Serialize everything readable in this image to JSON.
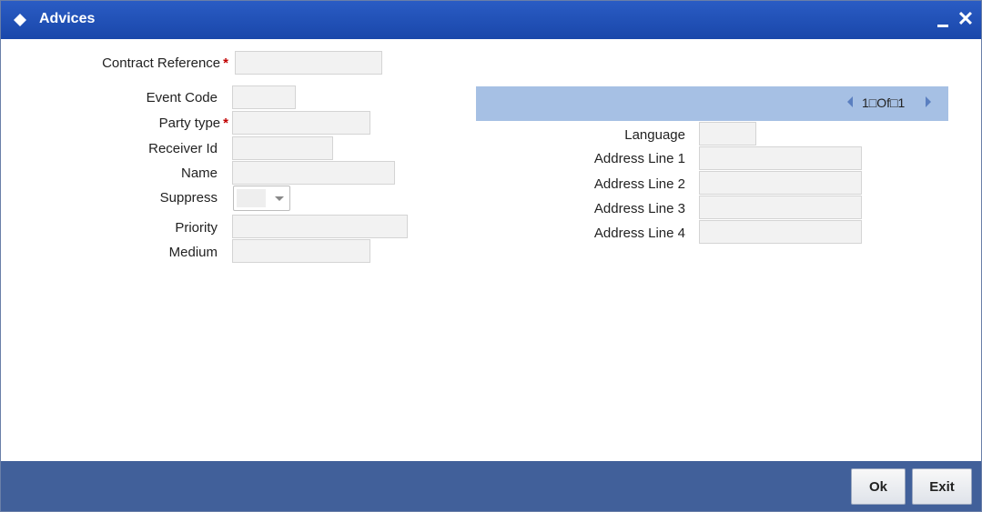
{
  "window": {
    "title": "Advices",
    "close_glyph": "✕"
  },
  "form": {
    "contract_reference": {
      "label": "Contract Reference",
      "required": "*",
      "value": ""
    },
    "event_code": {
      "label": "Event Code",
      "value": ""
    },
    "party_type": {
      "label": "Party type",
      "required": "*",
      "value": ""
    },
    "receiver_id": {
      "label": "Receiver Id",
      "value": ""
    },
    "name": {
      "label": "Name",
      "value": ""
    },
    "suppress": {
      "label": "Suppress",
      "value": ""
    },
    "priority": {
      "label": "Priority",
      "value": ""
    },
    "medium": {
      "label": "Medium",
      "value": ""
    }
  },
  "address": {
    "pager": {
      "text": "1□Of□1"
    },
    "language": {
      "label": "Language",
      "value": ""
    },
    "line1": {
      "label": "Address Line 1",
      "value": ""
    },
    "line2": {
      "label": "Address Line 2",
      "value": ""
    },
    "line3": {
      "label": "Address Line 3",
      "value": ""
    },
    "line4": {
      "label": "Address Line 4",
      "value": ""
    }
  },
  "footer": {
    "ok_label": "Ok",
    "exit_label": "Exit"
  },
  "colors": {
    "title_bar": "#1f4fb5",
    "footer": "#41609a",
    "pager": "#a6c0e4",
    "required": "#c00000"
  },
  "icons": {
    "title": "diamond-icon",
    "minimize": "minimize-icon",
    "close": "close-icon",
    "prev": "arrow-left-icon",
    "next": "arrow-right-icon",
    "dropdown": "chevron-down-icon"
  }
}
